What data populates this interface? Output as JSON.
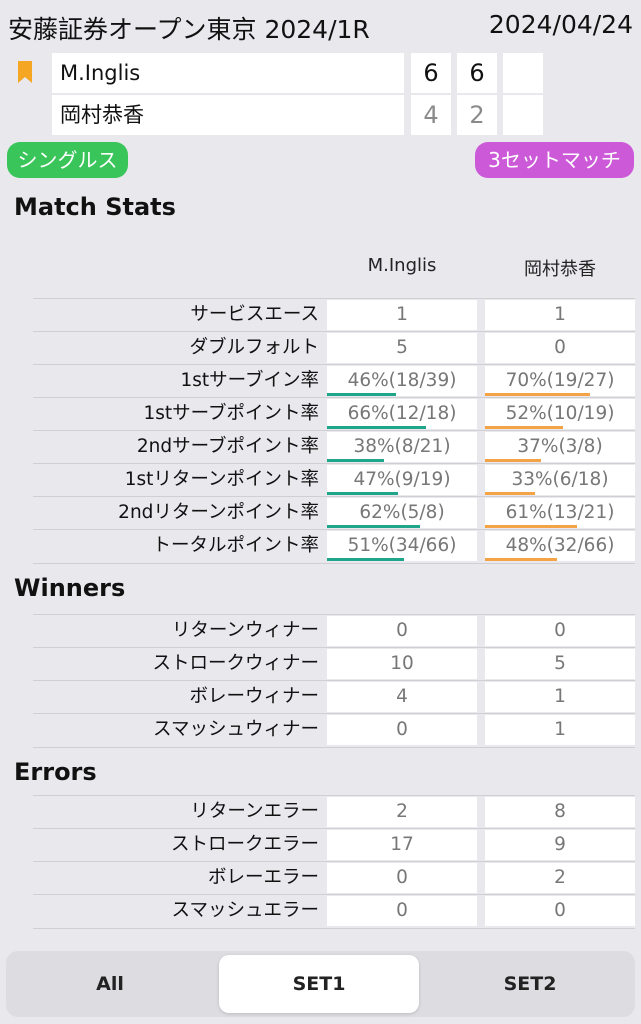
{
  "header": {
    "title": "安藤証券オープン東京 2024/1R",
    "date": "2024/04/24"
  },
  "players": [
    {
      "name": "M.Inglis",
      "bookmarked": true,
      "sets": [
        "6",
        "6",
        ""
      ]
    },
    {
      "name": "岡村恭香",
      "bookmarked": false,
      "sets": [
        "4",
        "2",
        ""
      ]
    }
  ],
  "tags": {
    "type": "シングルス",
    "format": "3セットマッチ"
  },
  "columns": [
    "M.Inglis",
    "岡村恭香"
  ],
  "sections": {
    "match_stats": {
      "title": "Match Stats",
      "rows": [
        {
          "label": "サービスエース",
          "p1": "1",
          "p2": "1"
        },
        {
          "label": "ダブルフォルト",
          "p1": "5",
          "p2": "0"
        },
        {
          "label": "1stサーブイン率",
          "p1": "46%(18/39)",
          "p2": "70%(19/27)",
          "p1_pct": 0.46,
          "p2_pct": 0.7
        },
        {
          "label": "1stサーブポイント率",
          "p1": "66%(12/18)",
          "p2": "52%(10/19)",
          "p1_pct": 0.66,
          "p2_pct": 0.52
        },
        {
          "label": "2ndサーブポイント率",
          "p1": "38%(8/21)",
          "p2": "37%(3/8)",
          "p1_pct": 0.38,
          "p2_pct": 0.37
        },
        {
          "label": "1stリターンポイント率",
          "p1": "47%(9/19)",
          "p2": "33%(6/18)",
          "p1_pct": 0.47,
          "p2_pct": 0.33
        },
        {
          "label": "2ndリターンポイント率",
          "p1": "62%(5/8)",
          "p2": "61%(13/21)",
          "p1_pct": 0.62,
          "p2_pct": 0.61
        },
        {
          "label": "トータルポイント率",
          "p1": "51%(34/66)",
          "p2": "48%(32/66)",
          "p1_pct": 0.51,
          "p2_pct": 0.48
        }
      ]
    },
    "winners": {
      "title": "Winners",
      "rows": [
        {
          "label": "リターンウィナー",
          "p1": "0",
          "p2": "0"
        },
        {
          "label": "ストロークウィナー",
          "p1": "10",
          "p2": "5"
        },
        {
          "label": "ボレーウィナー",
          "p1": "4",
          "p2": "1"
        },
        {
          "label": "スマッシュウィナー",
          "p1": "0",
          "p2": "1"
        }
      ]
    },
    "errors": {
      "title": "Errors",
      "rows": [
        {
          "label": "リターンエラー",
          "p1": "2",
          "p2": "8"
        },
        {
          "label": "ストロークエラー",
          "p1": "17",
          "p2": "9"
        },
        {
          "label": "ボレーエラー",
          "p1": "0",
          "p2": "2"
        },
        {
          "label": "スマッシュエラー",
          "p1": "0",
          "p2": "0"
        }
      ]
    }
  },
  "tabs": [
    {
      "label": "All",
      "active": false
    },
    {
      "label": "SET1",
      "active": true
    },
    {
      "label": "SET2",
      "active": false
    }
  ],
  "colors": {
    "bookmark": "#f5a623",
    "p1_bar": "#1fa58a",
    "p2_bar": "#f5a347",
    "singles_pill": "#3ac55a",
    "format_pill": "#cc59d8"
  }
}
